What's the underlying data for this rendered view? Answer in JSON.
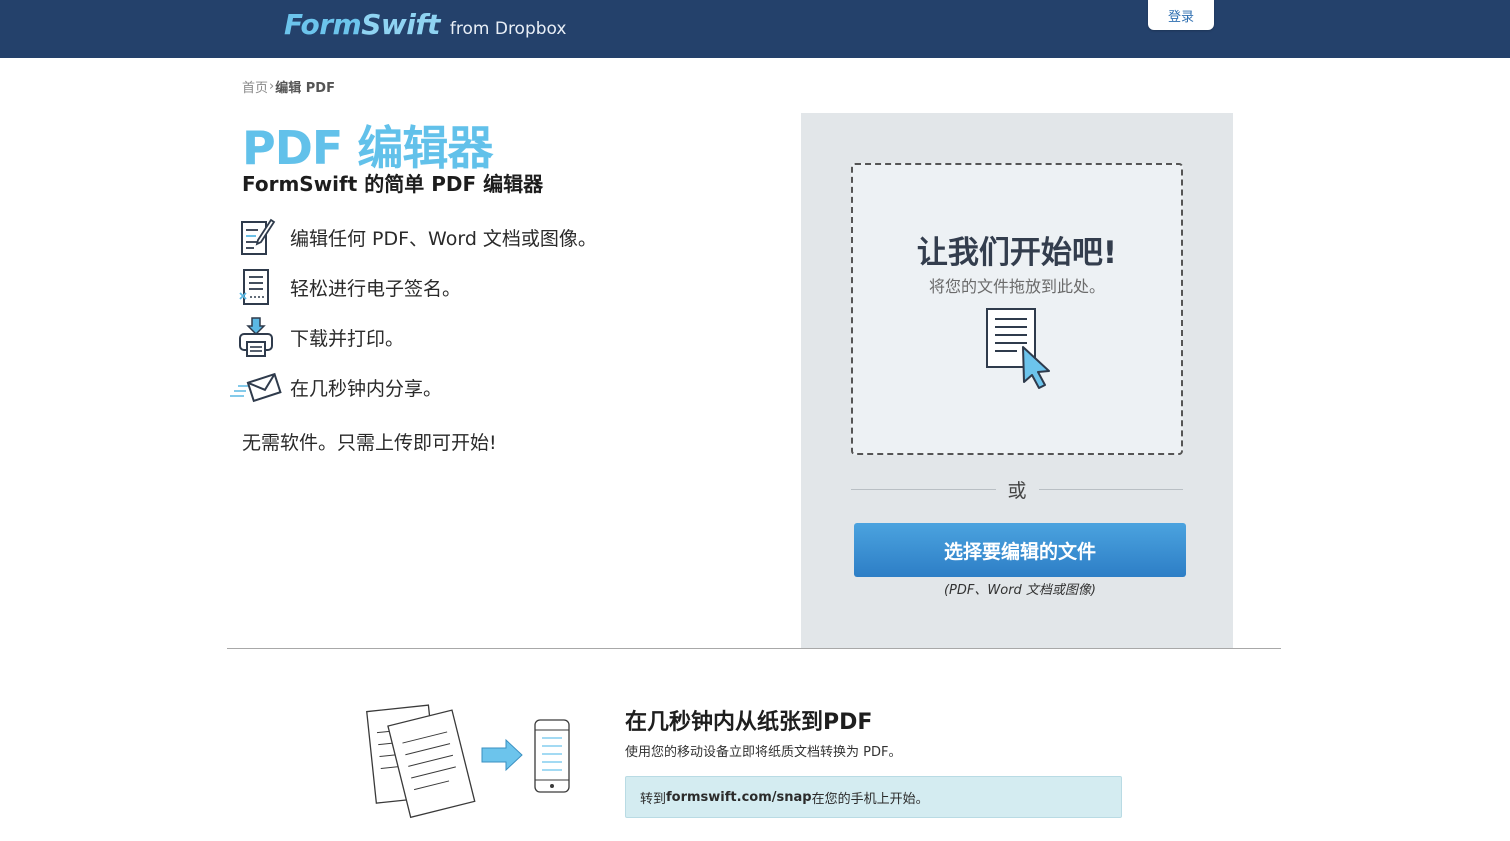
{
  "header": {
    "logo_text_1": "Form",
    "logo_text_2": "Swift",
    "logo_sub": "from Dropbox",
    "login_label": "登录"
  },
  "breadcrumb": {
    "home": "首页",
    "separator": "›",
    "current": "编辑 PDF"
  },
  "hero": {
    "title": "PDF 编辑器",
    "subtitle": "FormSwift 的简单 PDF 编辑器"
  },
  "features": [
    {
      "icon": "edit-document-icon",
      "label": "编辑任何 PDF、Word 文档或图像。"
    },
    {
      "icon": "signature-document-icon",
      "label": "轻松进行电子签名。"
    },
    {
      "icon": "download-print-icon",
      "label": "下载并打印。"
    },
    {
      "icon": "send-envelope-icon",
      "label": "在几秒钟内分享。"
    }
  ],
  "tagline": "无需软件。只需上传即可开始!",
  "upload": {
    "dropzone_title": "让我们开始吧!",
    "dropzone_sub": "将您的文件拖放到此处。",
    "or_label": "或",
    "choose_button": "选择要编辑的文件",
    "choose_note": "(PDF、Word 文档或图像)"
  },
  "promo": {
    "title": "在几秒钟内从纸张到PDF",
    "subtitle": "使用您的移动设备立即将纸质文档转换为 PDF。",
    "box_prefix": "转到",
    "box_link": "formswift.com/snap",
    "box_suffix": "在您的手机上开始。"
  },
  "colors": {
    "header_bg": "#24416b",
    "accent_blue": "#62c1ea",
    "button_blue": "#2d7ec6",
    "panel_bg": "#e2e6e9",
    "promo_box_bg": "#d4ecf1"
  }
}
